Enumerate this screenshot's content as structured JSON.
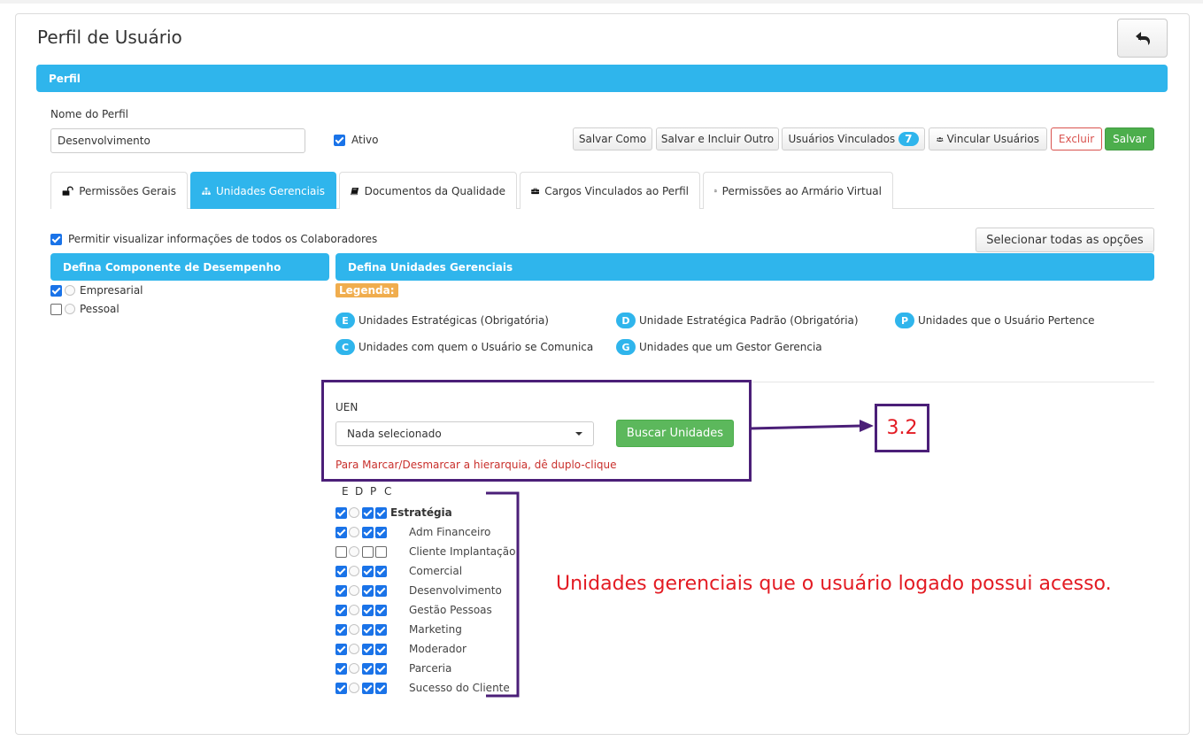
{
  "page": {
    "title": "Perfil de Usuário"
  },
  "perfil_section": {
    "header": "Perfil"
  },
  "form": {
    "nome_label": "Nome do Perfil",
    "nome_value": "Desenvolvimento",
    "ativo_label": "Ativo",
    "ativo_checked": true
  },
  "actions": {
    "salvar_como": "Salvar Como",
    "salvar_incluir": "Salvar e Incluir Outro",
    "usuarios_vinculados": "Usuários Vinculados",
    "usuarios_vinculados_count": "7",
    "vincular_usuarios": "Vincular Usuários",
    "excluir": "Excluir",
    "salvar": "Salvar"
  },
  "tabs": [
    {
      "label": "Permissões Gerais",
      "icon": "unlock-icon",
      "active": false
    },
    {
      "label": "Unidades Gerenciais",
      "icon": "sitemap-icon",
      "active": true
    },
    {
      "label": "Documentos da Qualidade",
      "icon": "book-icon",
      "active": false
    },
    {
      "label": "Cargos Vinculados ao Perfil",
      "icon": "briefcase-icon",
      "active": false
    },
    {
      "label": "Permissões ao Armário Virtual",
      "icon": "document-icon",
      "active": false
    }
  ],
  "permitir": {
    "label": "Permitir visualizar informações de todos os Colaboradores",
    "checked": true
  },
  "selecionar_todas": "Selecionar todas as opções",
  "componente": {
    "header": "Defina Componente de Desempenho",
    "items": [
      {
        "label": "Empresarial",
        "checked": true
      },
      {
        "label": "Pessoal",
        "checked": false
      }
    ]
  },
  "unidades": {
    "header": "Defina Unidades Gerenciais",
    "legenda_label": "Legenda:",
    "legend": [
      {
        "key": "E",
        "text": "Unidades Estratégicas (Obrigatória)"
      },
      {
        "key": "D",
        "text": "Unidade Estratégica Padrão (Obrigatória)"
      },
      {
        "key": "P",
        "text": "Unidades que o Usuário Pertence"
      },
      {
        "key": "C",
        "text": "Unidades com quem o Usuário se Comunica"
      },
      {
        "key": "G",
        "text": "Unidades que um Gestor Gerencia"
      }
    ],
    "uen_label": "UEN",
    "uen_value": "Nada selecionado",
    "buscar": "Buscar Unidades",
    "hint": "Para Marcar/Desmarcar a hierarquia, dê duplo-clique",
    "columns": [
      "E",
      "D",
      "P",
      "C"
    ],
    "tree": [
      {
        "label": "Estratégia",
        "root": true,
        "e": true,
        "p": true,
        "c": true
      },
      {
        "label": "Adm Financeiro",
        "root": false,
        "e": true,
        "p": true,
        "c": true
      },
      {
        "label": "Cliente Implantação",
        "root": false,
        "e": false,
        "p": false,
        "c": false
      },
      {
        "label": "Comercial",
        "root": false,
        "e": true,
        "p": true,
        "c": true
      },
      {
        "label": "Desenvolvimento",
        "root": false,
        "e": true,
        "p": true,
        "c": true
      },
      {
        "label": "Gestão Pessoas",
        "root": false,
        "e": true,
        "p": true,
        "c": true
      },
      {
        "label": "Marketing",
        "root": false,
        "e": true,
        "p": true,
        "c": true
      },
      {
        "label": "Moderador",
        "root": false,
        "e": true,
        "p": true,
        "c": true
      },
      {
        "label": "Parceria",
        "root": false,
        "e": true,
        "p": true,
        "c": true
      },
      {
        "label": "Sucesso do Cliente",
        "root": false,
        "e": true,
        "p": true,
        "c": true
      }
    ]
  },
  "annotations": {
    "callout_number": "3.2",
    "description": "Unidades gerenciais que o usuário logado possui acesso.",
    "color": "#e31b23",
    "frame_color": "#4b1f78"
  },
  "colors": {
    "accent": "#2fb5ec",
    "success": "#5cb85c",
    "danger": "#d9534f",
    "warning": "#f0ad4e"
  }
}
